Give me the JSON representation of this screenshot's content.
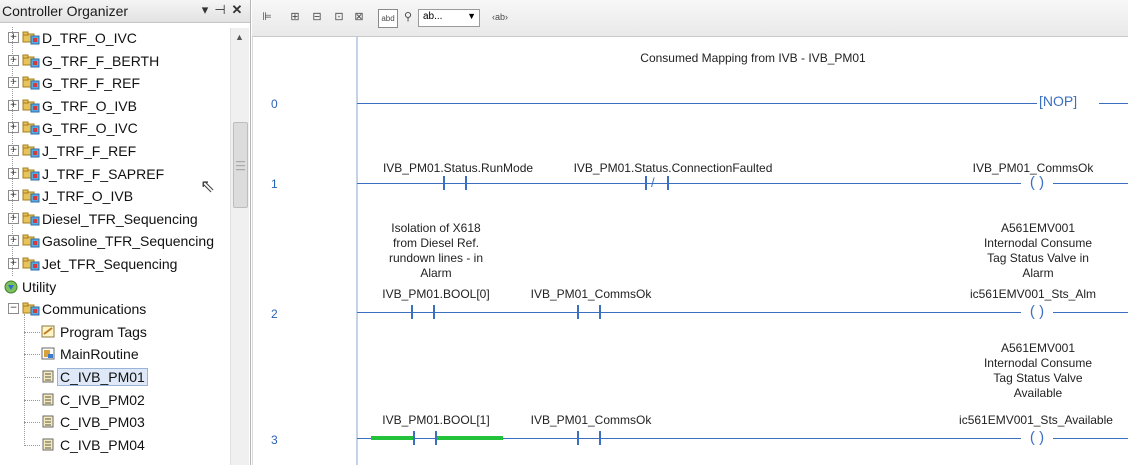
{
  "organizer": {
    "title": "Controller Organizer",
    "pin_glyph": "▾ ⊣",
    "close_glyph": "✕",
    "items": [
      {
        "label": "D_TRF_O_IVC",
        "type": "program",
        "expanded": false
      },
      {
        "label": "G_TRF_F_BERTH",
        "type": "program",
        "expanded": false
      },
      {
        "label": "G_TRF_F_REF",
        "type": "program",
        "expanded": false
      },
      {
        "label": "G_TRF_O_IVB",
        "type": "program",
        "expanded": false
      },
      {
        "label": "G_TRF_O_IVC",
        "type": "program",
        "expanded": false
      },
      {
        "label": "J_TRF_F_REF",
        "type": "program",
        "expanded": false
      },
      {
        "label": "J_TRF_F_SAPREF",
        "type": "program",
        "expanded": false
      },
      {
        "label": "J_TRF_O_IVB",
        "type": "program",
        "expanded": false
      },
      {
        "label": "Diesel_TFR_Sequencing",
        "type": "program",
        "expanded": false
      },
      {
        "label": "Gasoline_TFR_Sequencing",
        "type": "program",
        "expanded": false
      },
      {
        "label": "Jet_TFR_Sequencing",
        "type": "program",
        "expanded": false
      },
      {
        "label": "Utility",
        "type": "folder",
        "expanded": false
      },
      {
        "label": "Communications",
        "type": "program",
        "expanded": true
      },
      {
        "label": "Program Tags",
        "type": "tags"
      },
      {
        "label": "MainRoutine",
        "type": "routine-main"
      },
      {
        "label": "C_IVB_PM01",
        "type": "routine",
        "selected": true
      },
      {
        "label": "C_IVB_PM02",
        "type": "routine"
      },
      {
        "label": "C_IVB_PM03",
        "type": "routine"
      },
      {
        "label": "C_IVB_PM04",
        "type": "routine"
      }
    ]
  },
  "toolbar": {
    "icons": [
      "rung-icon",
      "branch-icon",
      "branch-level-icon",
      "contact-xic-icon",
      "contact-xio-icon",
      "abc-icon",
      "pin-icon",
      "element-combo",
      "tag-icon"
    ],
    "glyphs": [
      "⊫",
      "⊞",
      "⊟",
      "⊡",
      "⊠",
      "ab",
      "⚲",
      "ab",
      "‹ab›"
    ]
  },
  "ladder": {
    "rungs": [
      {
        "number": "0",
        "comment": "Consumed Mapping from IVB - IVB_PM01",
        "output": "NOP"
      },
      {
        "number": "1",
        "contacts": [
          {
            "tag": "IVB_PM01.Status.RunMode",
            "kind": "XIC"
          },
          {
            "tag": "IVB_PM01.Status.ConnectionFaulted",
            "kind": "XIO"
          }
        ],
        "coil": {
          "tag": "IVB_PM01_CommsOk"
        }
      },
      {
        "number": "2",
        "contacts": [
          {
            "tag": "IVB_PM01.BOOL[0]",
            "kind": "XIC",
            "description": [
              "Isolation of X618",
              "from Diesel Ref.",
              "rundown lines - in",
              "Alarm"
            ]
          },
          {
            "tag": "IVB_PM01_CommsOk",
            "kind": "XIC"
          }
        ],
        "coil": {
          "tag": "ic561EMV001_Sts_Alm",
          "description": [
            "A561EMV001",
            "Internodal Consume",
            "Tag Status Valve in",
            "Alarm"
          ]
        }
      },
      {
        "number": "3",
        "contacts": [
          {
            "tag": "IVB_PM01.BOOL[1]",
            "kind": "XIC",
            "energized": true
          },
          {
            "tag": "IVB_PM01_CommsOk",
            "kind": "XIC"
          }
        ],
        "coil": {
          "tag": "ic561EMV001_Sts_Available",
          "description": [
            "A561EMV001",
            "Internodal Consume",
            "Tag Status Valve",
            "Available"
          ]
        }
      }
    ]
  },
  "colors": {
    "wire": "#3b6fc2",
    "energized": "#22c33a",
    "rung_number": "#2a63b5",
    "selection": "#dfe8f6"
  }
}
